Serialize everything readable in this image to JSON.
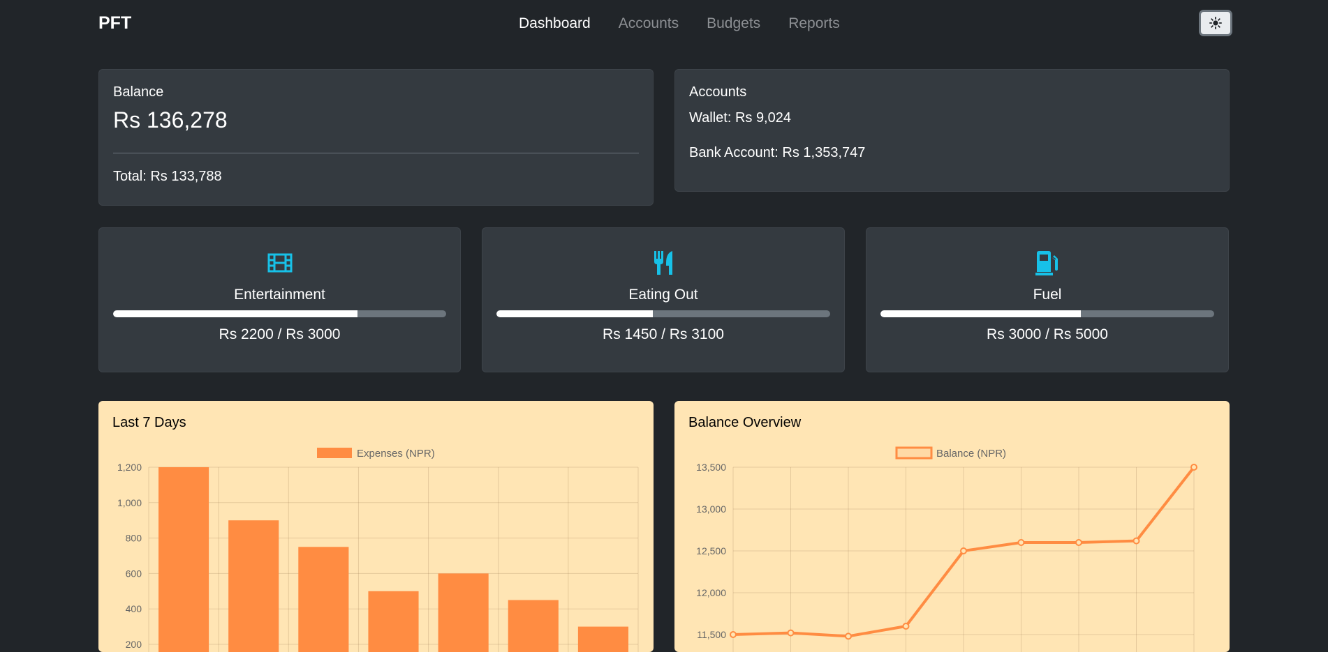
{
  "nav": {
    "brand": "PFT",
    "links": [
      {
        "label": "Dashboard",
        "active": true
      },
      {
        "label": "Accounts",
        "active": false
      },
      {
        "label": "Budgets",
        "active": false
      },
      {
        "label": "Reports",
        "active": false
      }
    ],
    "theme_icon": "sun-icon"
  },
  "balance": {
    "title": "Balance",
    "amount": "Rs 136,278",
    "total": "Total: Rs 133,788"
  },
  "accounts": {
    "title": "Accounts",
    "items": [
      {
        "label": "Wallet: Rs 9,024"
      },
      {
        "label": "Bank Account: Rs 1,353,747"
      }
    ]
  },
  "budgets": [
    {
      "name": "Entertainment",
      "icon": "film-icon",
      "amount": "Rs 2200 / Rs 3000",
      "progress": 0.7333
    },
    {
      "name": "Eating Out",
      "icon": "utensils-icon",
      "amount": "Rs 1450 / Rs 3100",
      "progress": 0.4677
    },
    {
      "name": "Fuel",
      "icon": "gas-pump-icon",
      "amount": "Rs 3000 / Rs 5000",
      "progress": 0.6
    }
  ],
  "colors": {
    "accent": "#17c1e8",
    "chart": "#ff8c42",
    "chart_bg": "#ffe5b4"
  },
  "charts": {
    "expenses_title": "Last 7 Days",
    "balance_title": "Balance Overview"
  },
  "chart_data": [
    {
      "type": "bar",
      "title": "Last 7 Days",
      "legend": "Expenses (NPR)",
      "legend_position": "top",
      "categories": [
        "",
        "",
        "",
        "",
        "",
        "",
        ""
      ],
      "values": [
        1200,
        900,
        750,
        500,
        600,
        450,
        300
      ],
      "ylim": [
        200,
        1200
      ],
      "yticks": [
        "1,200",
        "1,000",
        "800",
        "600",
        "400",
        "200"
      ],
      "grid": true
    },
    {
      "type": "line",
      "title": "Balance Overview",
      "legend": "Balance (NPR)",
      "legend_position": "top",
      "values": [
        11500,
        11520,
        11480,
        11600,
        12500,
        12600,
        12600,
        12620,
        13500
      ],
      "ylim": [
        11500,
        13500
      ],
      "yticks": [
        "13,500",
        "13,000",
        "12,500",
        "12,000",
        "11,500"
      ],
      "grid": true
    }
  ]
}
